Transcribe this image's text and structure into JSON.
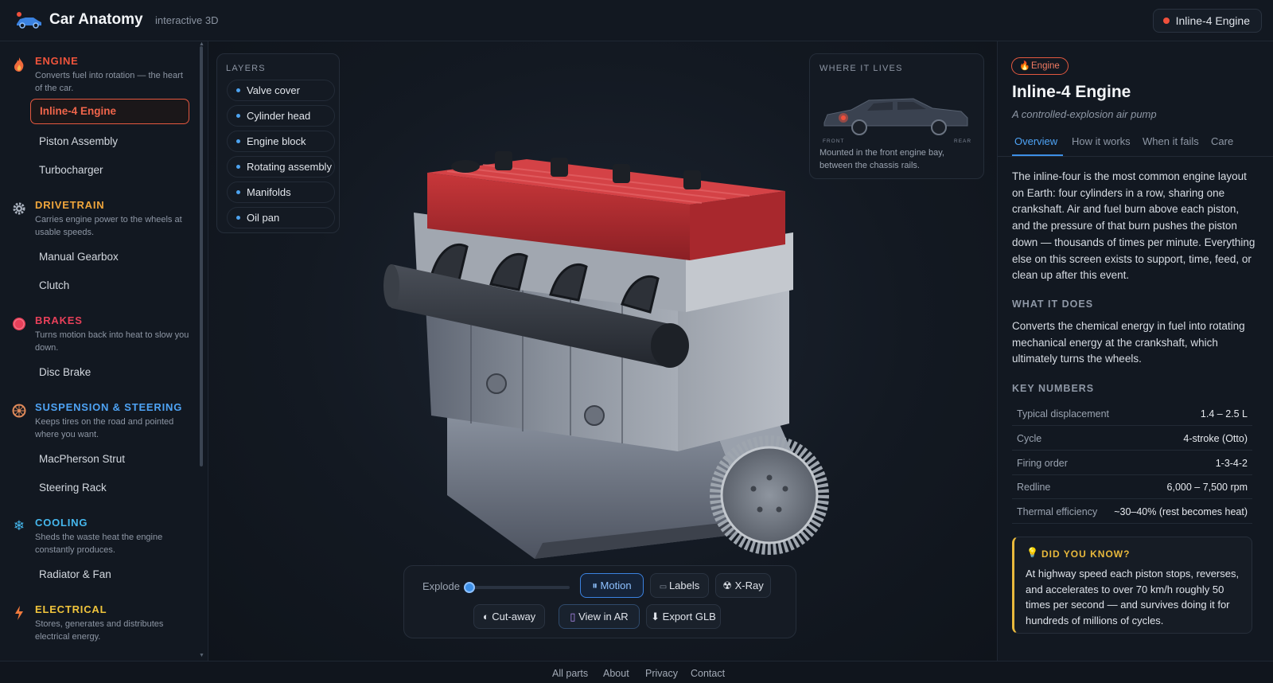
{
  "header": {
    "title": "Car Anatomy",
    "subtitle": "interactive 3D",
    "current_part": "Inline-4 Engine"
  },
  "sidebar": {
    "categories": [
      {
        "title": "ENGINE",
        "icon": "flame-icon",
        "color": "#f0543c",
        "desc": "Converts fuel into rotation — the heart of the car.",
        "items": [
          "Inline-4 Engine",
          "Piston Assembly",
          "Turbocharger"
        ]
      },
      {
        "title": "DRIVETRAIN",
        "icon": "gear-icon",
        "color": "#f0a63c",
        "desc": "Carries engine power to the wheels at usable speeds.",
        "items": [
          "Manual Gearbox",
          "Clutch"
        ]
      },
      {
        "title": "BRAKES",
        "icon": "disc-icon",
        "color": "#e8405a",
        "desc": "Turns motion back into heat to slow you down.",
        "items": [
          "Disc Brake"
        ]
      },
      {
        "title": "SUSPENSION & STEERING",
        "icon": "wheel-icon",
        "color": "#4ea3f5",
        "desc": "Keeps tires on the road and pointed where you want.",
        "items": [
          "MacPherson Strut",
          "Steering Rack"
        ]
      },
      {
        "title": "COOLING",
        "icon": "snowflake-icon",
        "color": "#46b8ee",
        "desc": "Sheds the waste heat the engine constantly produces.",
        "items": [
          "Radiator & Fan"
        ]
      },
      {
        "title": "ELECTRICAL",
        "icon": "bolt-icon",
        "color": "#f0c43c",
        "desc": "Stores, generates and distributes electrical energy.",
        "items": []
      }
    ]
  },
  "layers": {
    "title": "LAYERS",
    "items": [
      "Valve cover",
      "Cylinder head",
      "Engine block",
      "Rotating assembly",
      "Manifolds",
      "Oil pan"
    ]
  },
  "location": {
    "title": "WHERE IT LIVES",
    "front": "FRONT",
    "rear": "REAR",
    "caption": "Mounted in the front engine bay, between the chassis rails."
  },
  "controls": {
    "explode_label": "Explode",
    "explode_value": 0,
    "motion": "⏸ Motion",
    "labels": "Labels",
    "xray": "X-Ray",
    "cutaway": "◐ Cut-away",
    "view_ar": "View in AR",
    "export": "⬇ Export GLB"
  },
  "detail": {
    "badge": "Engine",
    "title": "Inline-4 Engine",
    "tagline": "A controlled-explosion air pump",
    "tabs": [
      "Overview",
      "How it works",
      "When it fails",
      "Care"
    ],
    "overview": "The inline-four is the most common engine layout on Earth: four cylinders in a row, sharing one crankshaft. Air and fuel burn above each piston, and the pressure of that burn pushes the piston down — thousands of times per minute. Everything else on this screen exists to support, time, feed, or clean up after this event.",
    "what_title": "WHAT IT DOES",
    "what_text": "Converts the chemical energy in fuel into rotating mechanical energy at the crankshaft, which ultimately turns the wheels.",
    "numbers_title": "KEY NUMBERS",
    "numbers": [
      {
        "k": "Typical displacement",
        "v": "1.4 – 2.5 L"
      },
      {
        "k": "Cycle",
        "v": "4-stroke (Otto)"
      },
      {
        "k": "Firing order",
        "v": "1-3-4-2"
      },
      {
        "k": "Redline",
        "v": "6,000 – 7,500 rpm"
      },
      {
        "k": "Thermal efficiency",
        "v": "~30–40% (rest becomes heat)"
      }
    ],
    "dyk_title": "DID YOU KNOW?",
    "dyk_text": "At highway speed each piston stops, reverses, and accelerates to over 70 km/h roughly 50 times per second — and survives doing it for hundreds of millions of cycles."
  },
  "footer": {
    "links": [
      "All parts",
      "About",
      "Privacy",
      "Contact"
    ]
  }
}
